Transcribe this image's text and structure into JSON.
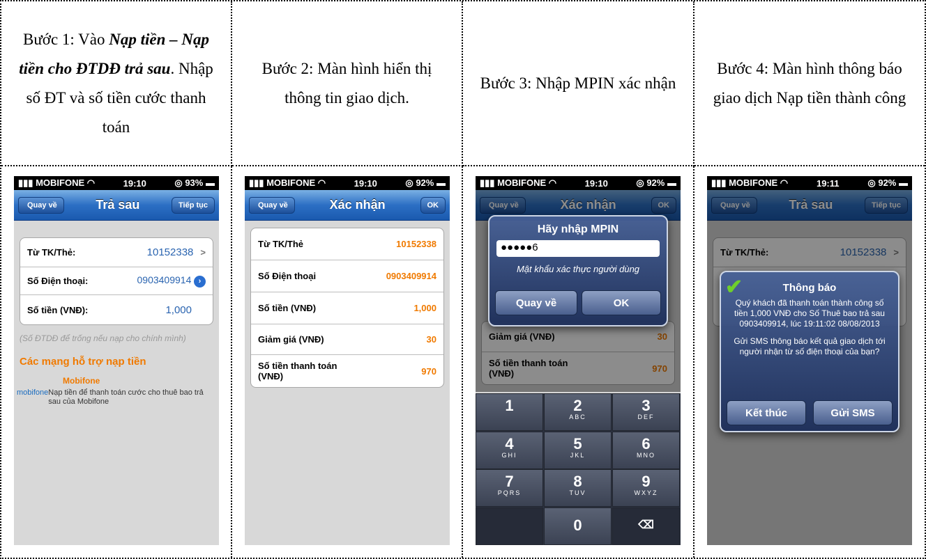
{
  "steps": [
    {
      "pre": "Bước 1: Vào ",
      "em": "Nạp tiền – Nạp tiền cho ĐTDĐ trả sau",
      "post": ". Nhập số ĐT và số tiền cước thanh toán"
    },
    {
      "text": "Bước 2: Màn hình hiển thị thông tin giao dịch."
    },
    {
      "text": "Bước 3: Nhập MPIN xác nhận"
    },
    {
      "text": "Bước 4: Màn hình thông báo giao dịch Nạp tiền thành công"
    }
  ],
  "s1": {
    "carrier": "MOBIFONE",
    "time": "19:10",
    "battery": "93%",
    "back": "Quay về",
    "title": "Trả sau",
    "next": "Tiếp tục",
    "rows": [
      {
        "label": "Từ TK/Thẻ:",
        "value": "10152338"
      },
      {
        "label": "Số Điện thoại:",
        "value": "0903409914"
      },
      {
        "label": "Số tiền (VNĐ):",
        "value": "1,000"
      }
    ],
    "hint": "(Số ĐTDĐ để trống nếu nạp cho chính mình)",
    "section": "Các mạng hỗ trợ nạp tiền",
    "net_name": "Mobifone",
    "logo": "mobifone",
    "net_desc": "Nạp tiền để thanh toán cước cho thuê bao trả sau của Mobifone"
  },
  "s2": {
    "carrier": "MOBIFONE",
    "time": "19:10",
    "battery": "92%",
    "back": "Quay về",
    "title": "Xác nhận",
    "ok": "OK",
    "rows": [
      {
        "label": "Từ TK/Thẻ",
        "value": "10152338"
      },
      {
        "label": "Số Điện thoại",
        "value": "0903409914"
      },
      {
        "label": "Số tiền (VNĐ)",
        "value": "1,000"
      },
      {
        "label": "Giảm giá (VNĐ)",
        "value": "30"
      },
      {
        "label": "Số tiền thanh toán (VNĐ)",
        "value": "970"
      }
    ]
  },
  "s3": {
    "carrier": "MOBIFONE",
    "time": "19:10",
    "battery": "92%",
    "back": "Quay về",
    "title": "Xác nhận",
    "ok": "OK",
    "rows": [
      {
        "label": "Giảm giá (VNĐ)",
        "value": "30"
      },
      {
        "label": "Số tiền thanh toán (VNĐ)",
        "value": "970"
      }
    ],
    "dialog_title": "Hãy nhập MPIN",
    "pin": "●●●●●6",
    "dialog_msg": "Mật khẩu xác thực người dùng",
    "btn_back": "Quay về",
    "btn_ok": "OK",
    "keys": [
      {
        "n": "1",
        "l": ""
      },
      {
        "n": "2",
        "l": "ABC"
      },
      {
        "n": "3",
        "l": "DEF"
      },
      {
        "n": "4",
        "l": "GHI"
      },
      {
        "n": "5",
        "l": "JKL"
      },
      {
        "n": "6",
        "l": "MNO"
      },
      {
        "n": "7",
        "l": "PQRS"
      },
      {
        "n": "8",
        "l": "TUV"
      },
      {
        "n": "9",
        "l": "WXYZ"
      },
      {
        "n": "",
        "l": ""
      },
      {
        "n": "0",
        "l": ""
      },
      {
        "n": "⌫",
        "l": ""
      }
    ]
  },
  "s4": {
    "carrier": "MOBIFONE",
    "time": "19:11",
    "battery": "92%",
    "back": "Quay về",
    "title": "Trả sau",
    "next": "Tiếp tục",
    "row_label": "Từ TK/Thẻ:",
    "row_value": "10152338",
    "dialog_title": "Thông báo",
    "msg1": "Quý khách đã thanh toán thành công số tiền 1,000 VNĐ cho Số Thuê bao trả sau 0903409914, lúc 19:11:02 08/08/2013",
    "msg2": "Gửi SMS thông báo kết quả giao dịch tới người nhận từ số điện thoại của bạn?",
    "btn_end": "Kết thúc",
    "btn_sms": "Gửi SMS"
  }
}
